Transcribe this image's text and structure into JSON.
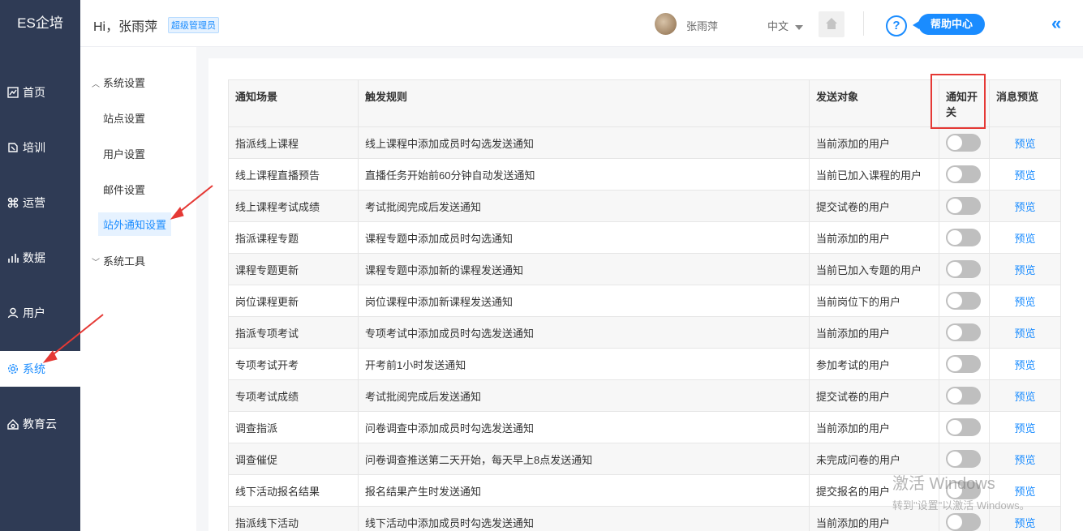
{
  "app": {
    "brand": "ES企培"
  },
  "header": {
    "greeting": "Hi，张雨萍",
    "role_badge": "超级管理员",
    "username": "张雨萍",
    "language": "中文",
    "help_label": "帮助中心",
    "help_icon_text": "?",
    "collapse_icon": "«"
  },
  "sidebar": {
    "items": [
      {
        "label": "首页",
        "icon": "chart-icon"
      },
      {
        "label": "培训",
        "icon": "book-icon"
      },
      {
        "label": "运营",
        "icon": "command-icon"
      },
      {
        "label": "数据",
        "icon": "bar-chart-icon"
      },
      {
        "label": "用户",
        "icon": "user-icon"
      },
      {
        "label": "系统",
        "icon": "gear-icon",
        "active": true
      },
      {
        "label": "教育云",
        "icon": "cloud-icon"
      }
    ]
  },
  "submenu": {
    "group1": "系统设置",
    "items": [
      "站点设置",
      "用户设置",
      "邮件设置",
      "站外通知设置"
    ],
    "group2": "系统工具"
  },
  "table": {
    "headers": [
      "通知场景",
      "触发规则",
      "发送对象",
      "通知开关",
      "消息预览"
    ],
    "preview_label": "预览",
    "rows": [
      {
        "scene": "指派线上课程",
        "rule": "线上课程中添加成员时勾选发送通知",
        "target": "当前添加的用户",
        "enabled": false
      },
      {
        "scene": "线上课程直播预告",
        "rule": "直播任务开始前60分钟自动发送通知",
        "target": "当前已加入课程的用户",
        "enabled": false
      },
      {
        "scene": "线上课程考试成绩",
        "rule": "考试批阅完成后发送通知",
        "target": "提交试卷的用户",
        "enabled": false
      },
      {
        "scene": "指派课程专题",
        "rule": "课程专题中添加成员时勾选通知",
        "target": "当前添加的用户",
        "enabled": false
      },
      {
        "scene": "课程专题更新",
        "rule": "课程专题中添加新的课程发送通知",
        "target": "当前已加入专题的用户",
        "enabled": false
      },
      {
        "scene": "岗位课程更新",
        "rule": "岗位课程中添加新课程发送通知",
        "target": "当前岗位下的用户",
        "enabled": false
      },
      {
        "scene": "指派专项考试",
        "rule": "专项考试中添加成员时勾选发送通知",
        "target": "当前添加的用户",
        "enabled": false
      },
      {
        "scene": "专项考试开考",
        "rule": "开考前1小时发送通知",
        "target": "参加考试的用户",
        "enabled": false
      },
      {
        "scene": "专项考试成绩",
        "rule": "考试批阅完成后发送通知",
        "target": "提交试卷的用户",
        "enabled": false
      },
      {
        "scene": "调查指派",
        "rule": "问卷调查中添加成员时勾选发送通知",
        "target": "当前添加的用户",
        "enabled": false
      },
      {
        "scene": "调查催促",
        "rule": "问卷调查推送第二天开始，每天早上8点发送通知",
        "target": "未完成问卷的用户",
        "enabled": false
      },
      {
        "scene": "线下活动报名结果",
        "rule": "报名结果产生时发送通知",
        "target": "提交报名的用户",
        "enabled": false
      },
      {
        "scene": "指派线下活动",
        "rule": "线下活动中添加成员时勾选发送通知",
        "target": "当前添加的用户",
        "enabled": false
      }
    ]
  },
  "watermark": {
    "line1": "激活 Windows",
    "line2": "转到\"设置\"以激活 Windows。"
  },
  "colors": {
    "sidebar_bg": "#2f3b55",
    "accent": "#1a8cff",
    "annotation_red": "#e53935",
    "toggle_off": "#bfbfbf"
  }
}
